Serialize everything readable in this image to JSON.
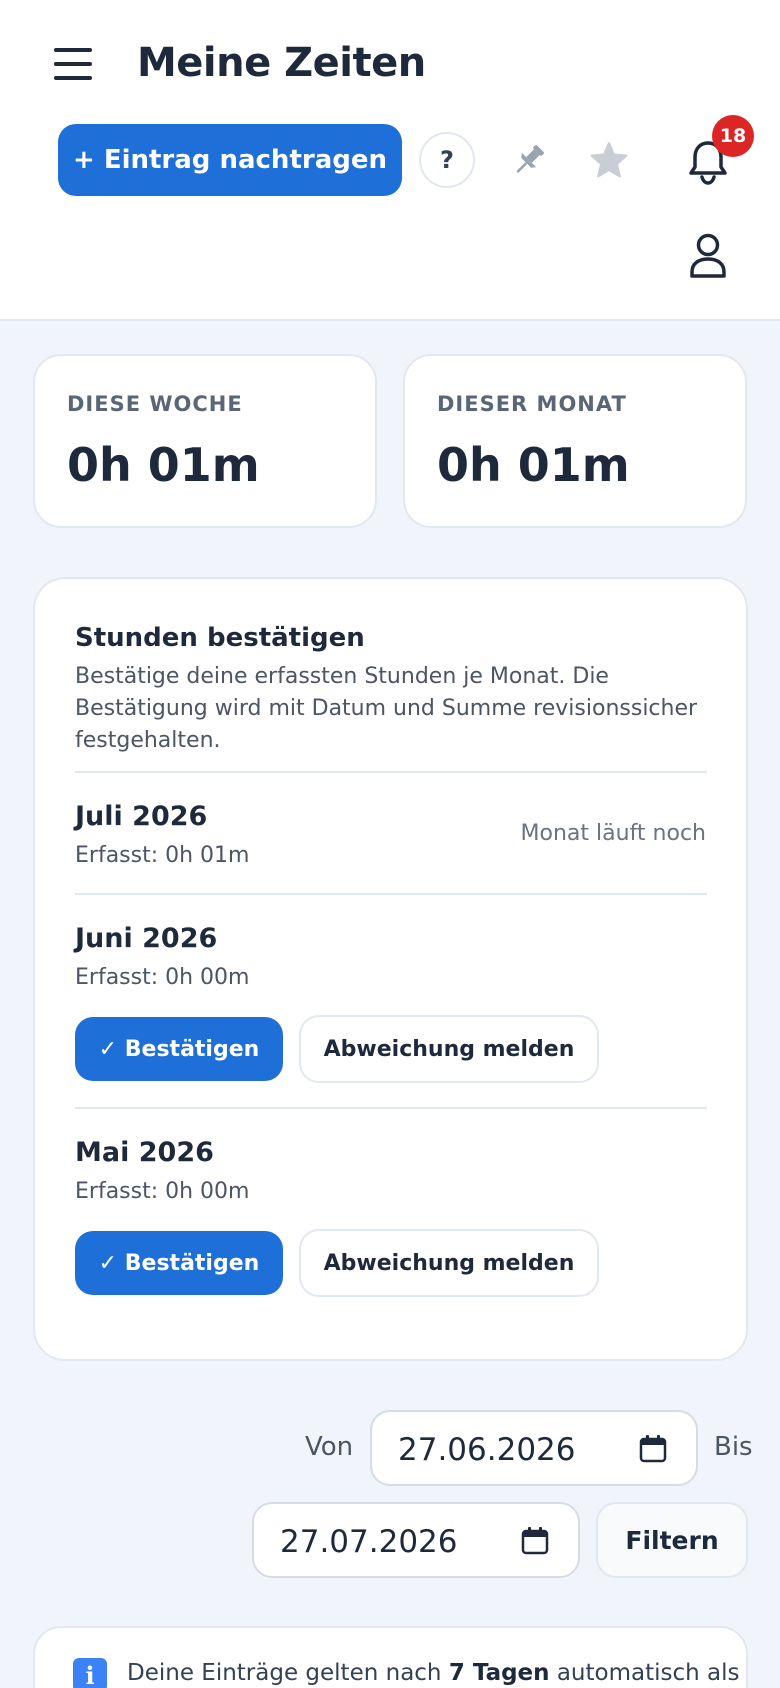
{
  "header": {
    "title": "Meine Zeiten",
    "add_entry_label": "+ Eintrag nachtragen",
    "help_label": "?",
    "notification_count": "18"
  },
  "stats": [
    {
      "label": "DIESE WOCHE",
      "value": "0h 01m"
    },
    {
      "label": "DIESER MONAT",
      "value": "0h 01m"
    }
  ],
  "confirm": {
    "title": "Stunden bestätigen",
    "description": "Bestätige deine erfassten Stunden je Monat. Die Bestätigung wird mit Datum und Summe revisionssicher festgehalten.",
    "months": [
      {
        "name": "Juli 2026",
        "sum": "Erfasst: 0h 01m",
        "status": "Monat läuft noch"
      },
      {
        "name": "Juni 2026",
        "sum": "Erfasst: 0h 00m",
        "confirm_label": "✓ Bestätigen",
        "report_label": "Abweichung melden"
      },
      {
        "name": "Mai 2026",
        "sum": "Erfasst: 0h 00m",
        "confirm_label": "✓ Bestätigen",
        "report_label": "Abweichung melden"
      }
    ]
  },
  "filter": {
    "from_label": "Von",
    "from_value": "27.06.2026",
    "to_label": "Bis",
    "to_value": "27.07.2026",
    "button_label": "Filtern"
  },
  "info": {
    "icon": "info-icon",
    "text_before": "Deine Einträge gelten nach ",
    "text_bold": "7 Tagen",
    "text_after": " automatisch als"
  },
  "colors": {
    "primary": "#1f6fd8",
    "badge": "#dc2626",
    "background": "#f1f5fb"
  }
}
